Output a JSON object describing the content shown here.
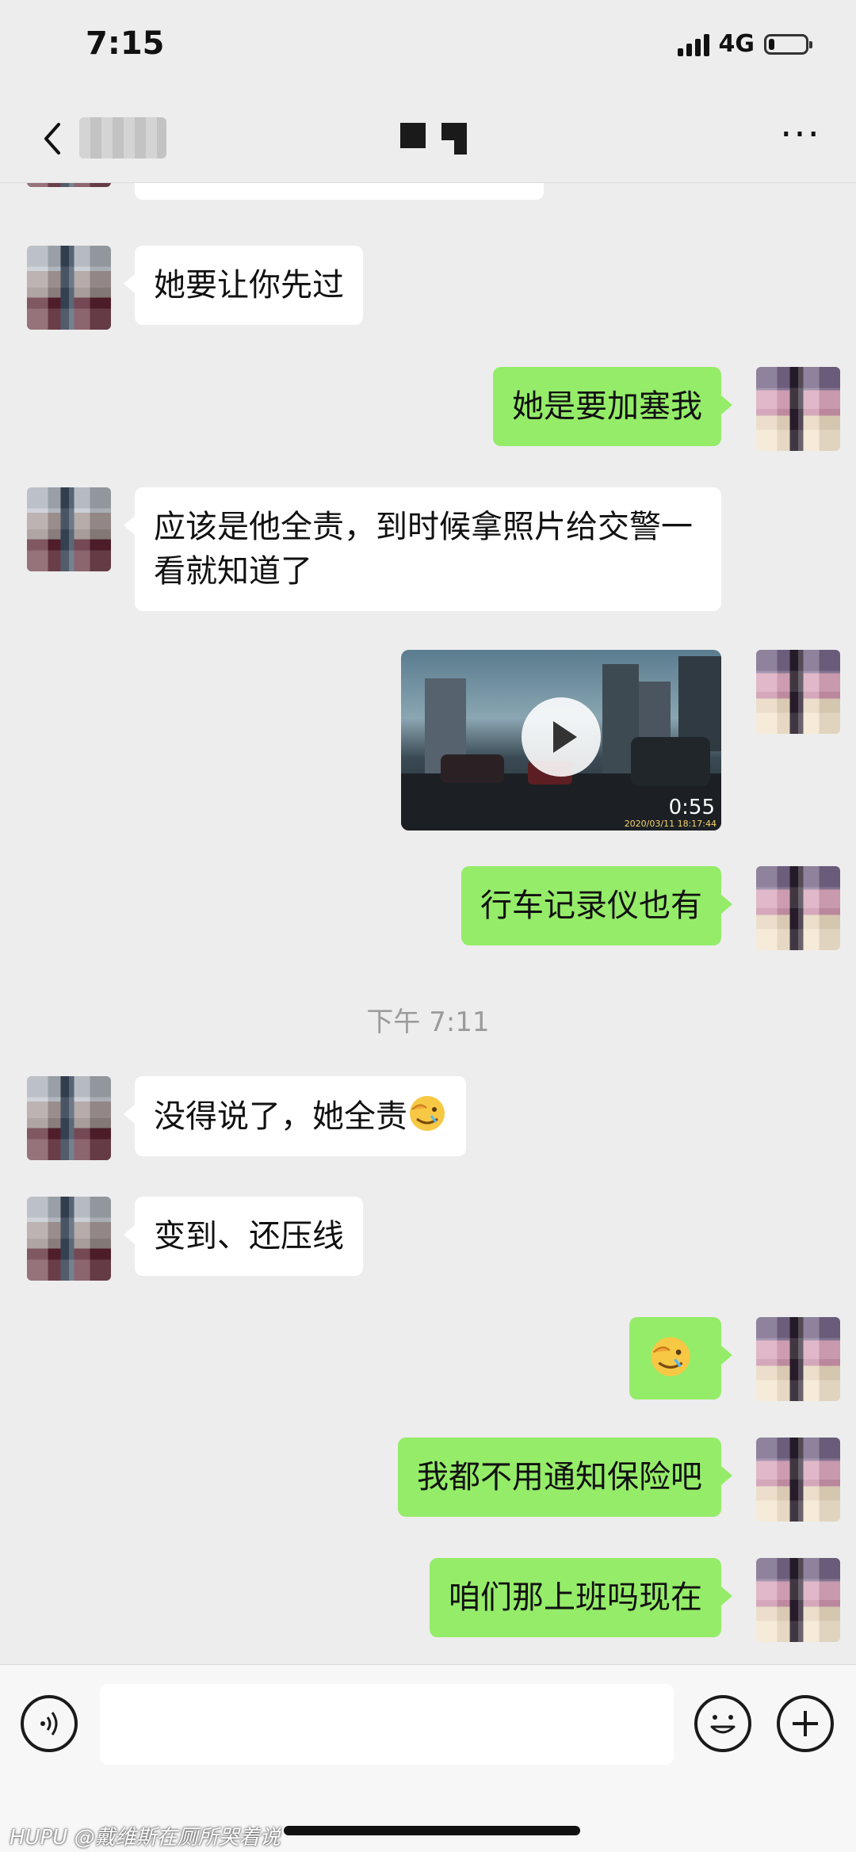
{
  "status_bar": {
    "time": "7:15",
    "network": "4G",
    "battery_level": 0.15
  },
  "nav": {
    "back_icon": "chevron-left-icon",
    "more_icon": "more-icon"
  },
  "messages": [
    {
      "side": "in",
      "type": "text",
      "text": "她要让你先过"
    },
    {
      "side": "out",
      "type": "text",
      "text": "她是要加塞我"
    },
    {
      "side": "in",
      "type": "text",
      "text": "应该是他全责，到时候拿照片给交警一看就知道了"
    },
    {
      "side": "out",
      "type": "video",
      "duration": "0:55",
      "stamp": "2020/03/11  18:17:44"
    },
    {
      "side": "out",
      "type": "text",
      "text": "行车记录仪也有"
    },
    {
      "type": "timestamp",
      "text": "下午 7:11"
    },
    {
      "side": "in",
      "type": "text",
      "text": "没得说了，她全责",
      "emoji": "facepalm-emoji"
    },
    {
      "side": "in",
      "type": "text",
      "text": "变到、还压线"
    },
    {
      "side": "out",
      "type": "emoji",
      "emoji": "facepalm-emoji"
    },
    {
      "side": "out",
      "type": "text",
      "text": "我都不用通知保险吧"
    },
    {
      "side": "out",
      "type": "text",
      "text": "咱们那上班吗现在"
    }
  ],
  "input_bar": {
    "voice_icon": "voice-icon",
    "emoji_icon": "emoji-icon",
    "plus_icon": "plus-icon",
    "text_value": ""
  },
  "watermark": {
    "brand": "HUPU",
    "text": "@戴维斯在厕所哭着说"
  }
}
